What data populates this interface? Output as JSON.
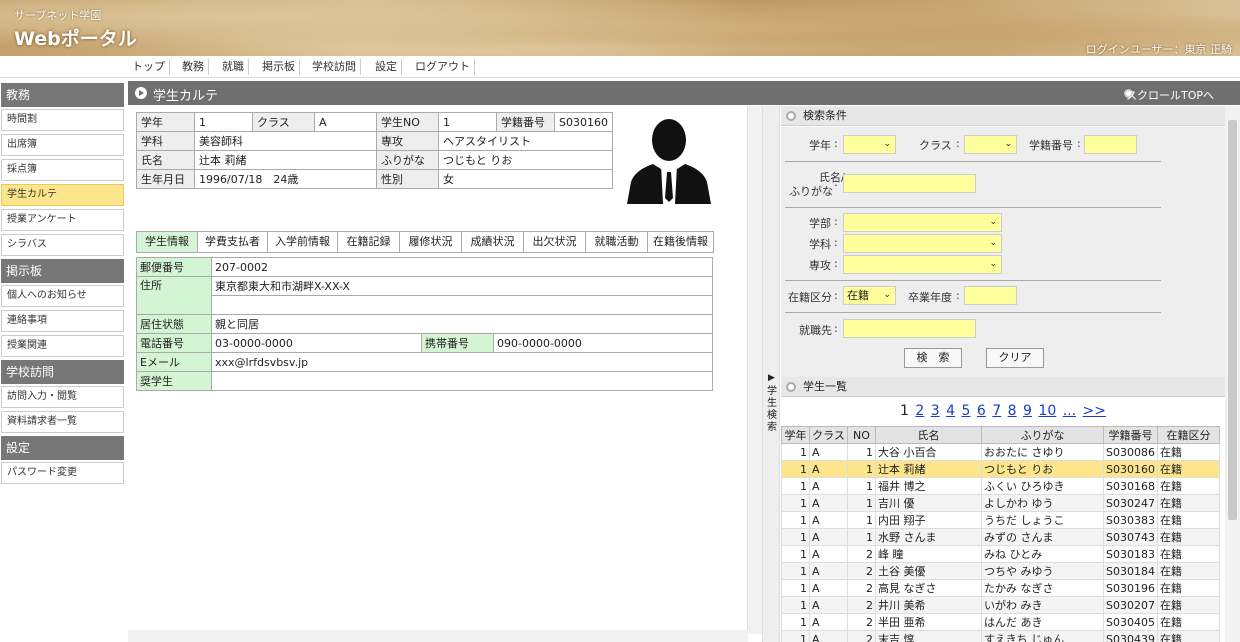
{
  "header": {
    "brand_sub": "サーブネット学園",
    "brand_main": "Webポータル",
    "login_user": "ログインユーザー：東京 正騎"
  },
  "topnav": [
    "トップ",
    "教務",
    "就職",
    "掲示板",
    "学校訪問",
    "設定",
    "ログアウト"
  ],
  "sidebar": {
    "kyomu": {
      "title": "教務",
      "items": [
        "時間割",
        "出席簿",
        "採点簿",
        "学生カルテ",
        "授業アンケート",
        "シラバス"
      ]
    },
    "keijiban": {
      "title": "掲示板",
      "items": [
        "個人へのお知らせ",
        "連絡事項",
        "授業関連"
      ]
    },
    "gakkohomon": {
      "title": "学校訪問",
      "items": [
        "訪問入力・閲覧",
        "資料請求者一覧"
      ]
    },
    "settei": {
      "title": "設定",
      "items": [
        "パスワード変更"
      ]
    },
    "active": "学生カルテ"
  },
  "title": {
    "page": "学生カルテ",
    "scroll_top": "スクロールTOPへ"
  },
  "student": {
    "grade_l": "学年",
    "grade": "1",
    "class_l": "クラス",
    "class": "A",
    "no_l": "学生NO",
    "no": "1",
    "id_l": "学籍番号",
    "id": "S030160",
    "dept_l": "学科",
    "dept": "美容師科",
    "major_l": "専攻",
    "major": "ヘアスタイリスト",
    "name_l": "氏名",
    "name": "辻本 莉緒",
    "kana_l": "ふりがな",
    "kana": "つじもと りお",
    "birth_l": "生年月日",
    "birth": "1996/07/18　24歳",
    "sex_l": "性別",
    "sex": "女"
  },
  "tabs": [
    "学生情報",
    "学費支払者",
    "入学前情報",
    "在籍記録",
    "履修状況",
    "成績状況",
    "出欠状況",
    "就職活動",
    "在籍後情報"
  ],
  "detail": {
    "zip_l": "郵便番号",
    "zip": "207-0002",
    "addr_l": "住所",
    "addr": "東京都東大和市湖畔X-XX-X",
    "living_l": "居住状態",
    "living": "親と同居",
    "tel_l": "電話番号",
    "tel": "03-0000-0000",
    "mobile_l": "携帯番号",
    "mobile": "090-0000-0000",
    "email_l": "Eメール",
    "email": "xxx@lrfdsvbsv.jp",
    "scholar_l": "奨学生",
    "scholar": ""
  },
  "toggle": {
    "arrow": "▶",
    "label": "学生検索"
  },
  "search": {
    "title": "検索条件",
    "grade_l": "学年",
    "class_l": "クラス",
    "id_l": "学籍番号",
    "name_l": "氏名/",
    "name_l2": "ふりがな",
    "faculty_l": "学部",
    "dept_l": "学科",
    "major_l": "専攻",
    "status_l": "在籍区分",
    "status_v": "在籍",
    "gradyear_l": "卒業年度",
    "job_l": "就職先",
    "search_btn": "検　索",
    "clear_btn": "クリア"
  },
  "list": {
    "title": "学生一覧",
    "pager": {
      "current": "1",
      "pages": [
        "2",
        "3",
        "4",
        "5",
        "6",
        "7",
        "8",
        "9",
        "10"
      ],
      "more": "...",
      "next": ">>"
    },
    "headers": [
      "学年",
      "クラス",
      "NO",
      "氏名",
      "ふりがな",
      "学籍番号",
      "在籍区分"
    ],
    "rows": [
      [
        "1",
        "A",
        "1",
        "大谷 小百合",
        "おおたに さゆり",
        "S030086",
        "在籍"
      ],
      [
        "1",
        "A",
        "1",
        "辻本 莉緒",
        "つじもと りお",
        "S030160",
        "在籍"
      ],
      [
        "1",
        "A",
        "1",
        "福井 博之",
        "ふくい ひろゆき",
        "S030168",
        "在籍"
      ],
      [
        "1",
        "A",
        "1",
        "吉川 優",
        "よしかわ ゆう",
        "S030247",
        "在籍"
      ],
      [
        "1",
        "A",
        "1",
        "内田 翔子",
        "うちだ しょうこ",
        "S030383",
        "在籍"
      ],
      [
        "1",
        "A",
        "1",
        "水野 さんま",
        "みずの さんま",
        "S030743",
        "在籍"
      ],
      [
        "1",
        "A",
        "2",
        "峰 瞳",
        "みね ひとみ",
        "S030183",
        "在籍"
      ],
      [
        "1",
        "A",
        "2",
        "土谷 美優",
        "つちや みゆう",
        "S030184",
        "在籍"
      ],
      [
        "1",
        "A",
        "2",
        "高見 なぎさ",
        "たかみ なぎさ",
        "S030196",
        "在籍"
      ],
      [
        "1",
        "A",
        "2",
        "井川 美希",
        "いがわ みき",
        "S030207",
        "在籍"
      ],
      [
        "1",
        "A",
        "2",
        "半田 亜希",
        "はんだ あき",
        "S030405",
        "在籍"
      ],
      [
        "1",
        "A",
        "2",
        "末吉 惇",
        "すえきち じゅん",
        "S030439",
        "在籍"
      ]
    ],
    "selected_row": 1
  }
}
